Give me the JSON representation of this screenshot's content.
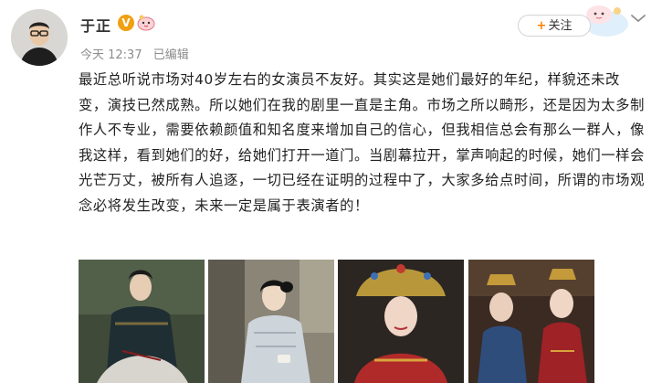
{
  "user": {
    "name": "于正",
    "verified_badge": "V",
    "level_icon": "cloud-mascot-icon"
  },
  "meta": {
    "time": "今天 12:37",
    "edited": "已编辑"
  },
  "follow": {
    "plus": "+",
    "label": "关注"
  },
  "post": {
    "text": "最近总听说市场对40岁左右的女演员不友好。其实这是她们最好的年纪，样貌还未改变，演技已然成熟。所以她们在我的剧里一直是主角。市场之所以畸形，还是因为太多制作人不专业，需要依赖颜值和知名度来增加自己的信心，但我相信总会有那么一群人，像我这样，看到她们的好，给她们打开一道门。当剧幕拉开，掌声响起的时候，她们一样会光芒万丈，被所有人追逐，一切已经在证明的过程中了，大家多给点时间，所谓的市场观念必将发生改变，未来一定是属于表演者的！"
  },
  "photos": [
    {
      "subject": "woman-sewing-photo"
    },
    {
      "subject": "woman-with-teacup-photo"
    },
    {
      "subject": "woman-in-headdress-photo"
    },
    {
      "subject": "two-women-in-court-robes-photo"
    }
  ],
  "colors": {
    "follow_plus": "#ff8200",
    "verified": "#f0a011",
    "meta_text": "#8c8c8c"
  }
}
